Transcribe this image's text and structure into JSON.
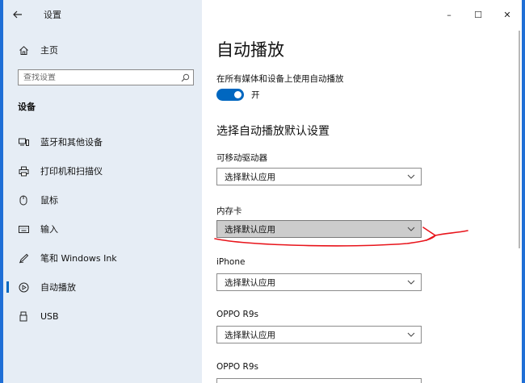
{
  "window": {
    "app_title": "设置",
    "controls": {
      "minimize": "–",
      "maximize": "☐",
      "close": "✕"
    }
  },
  "sidebar": {
    "home": {
      "label": "主页",
      "icon": "home-icon"
    },
    "search": {
      "placeholder": "查找设置",
      "icon": "search-icon"
    },
    "section": "设备",
    "items": [
      {
        "label": "蓝牙和其他设备",
        "icon": "bluetooth-devices-icon",
        "selected": false
      },
      {
        "label": "打印机和扫描仪",
        "icon": "printer-icon",
        "selected": false
      },
      {
        "label": "鼠标",
        "icon": "mouse-icon",
        "selected": false
      },
      {
        "label": "输入",
        "icon": "keyboard-icon",
        "selected": false
      },
      {
        "label": "笔和 Windows Ink",
        "icon": "pen-icon",
        "selected": false
      },
      {
        "label": "自动播放",
        "icon": "autoplay-icon",
        "selected": true
      },
      {
        "label": "USB",
        "icon": "usb-icon",
        "selected": false
      }
    ]
  },
  "main": {
    "title": "自动播放",
    "toggle": {
      "description": "在所有媒体和设备上使用自动播放",
      "state_label": "开",
      "on": true
    },
    "defaults_title": "选择自动播放默认设置",
    "fields": [
      {
        "label": "可移动驱动器",
        "value": "选择默认应用",
        "highlighted": false
      },
      {
        "label": "内存卡",
        "value": "选择默认应用",
        "highlighted": true
      },
      {
        "label": "iPhone",
        "value": "选择默认应用",
        "highlighted": false
      },
      {
        "label": "OPPO R9s",
        "value": "选择默认应用",
        "highlighted": false
      },
      {
        "label": "OPPO R9s",
        "value": "",
        "highlighted": false
      }
    ]
  },
  "colors": {
    "accent": "#0067c0",
    "sidebar_bg": "#e6edf5",
    "annotation": "#e8141b",
    "desktop": "#1f6fd6"
  }
}
